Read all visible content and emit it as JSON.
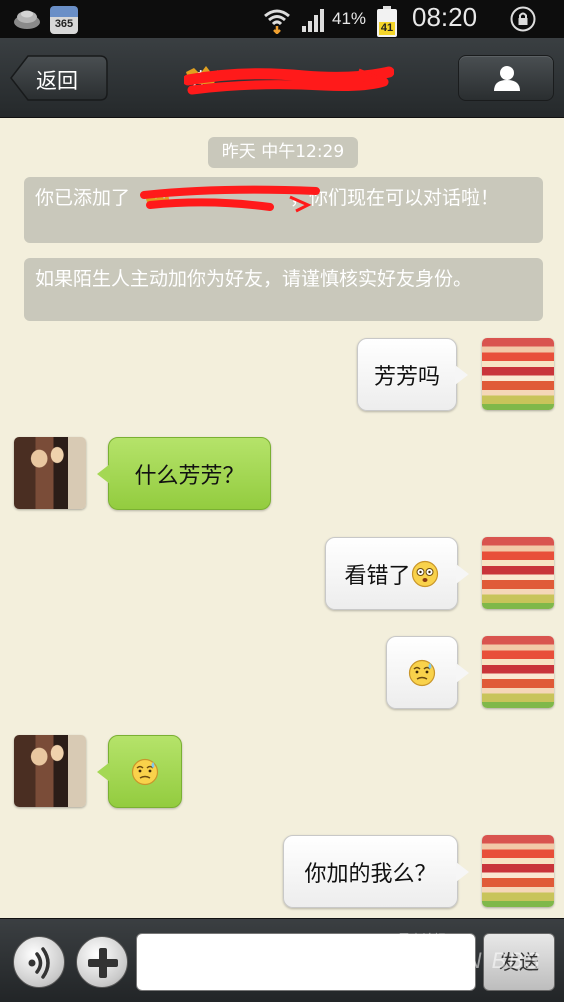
{
  "status_bar": {
    "calendar_day": "365",
    "battery_percent": "41%",
    "battery_level": "41",
    "time": "08:20",
    "icons": [
      "settings-icon",
      "calendar-icon",
      "wifi-icon",
      "signal-icon",
      "battery-icon",
      "lock-icon"
    ]
  },
  "header": {
    "back_label": "返回",
    "contact_name": "芬",
    "contact_icon": "person-icon"
  },
  "conversation": {
    "timestamp": "昨天 中午12:29",
    "system_messages": [
      "你已添加了，你们现在可以对话啦！",
      "如果陌生人主动加你为好友，请谨慎核实好友身份。"
    ],
    "system_message_1_prefix": "你已添加了",
    "system_message_1_suffix": "，你们现在可以对话啦！",
    "messages": [
      {
        "sender": "me",
        "text": "芳芳吗"
      },
      {
        "sender": "friend",
        "text": "什么芳芳？"
      },
      {
        "sender": "me",
        "text": "看错了",
        "emoji": "shocked-face-emoji"
      },
      {
        "sender": "me",
        "text": "",
        "emoji": "sweat-face-emoji"
      },
      {
        "sender": "friend",
        "text": "",
        "emoji": "sweat-face-emoji"
      },
      {
        "sender": "me",
        "text": "你加的我么？"
      }
    ]
  },
  "input_bar": {
    "voice_icon": "voice-icon",
    "plus_icon": "plus-icon",
    "input_value": "",
    "send_label": "发送",
    "watermark": "KUNSHAN BBS",
    "watermark_sub": "昆山论坛"
  },
  "colors": {
    "background": "#f3efdc",
    "friend_bubble": "#a4d854",
    "my_bubble": "#ffffff",
    "system_pill": "#c9c8bb",
    "redaction": "#ff1a1a"
  }
}
